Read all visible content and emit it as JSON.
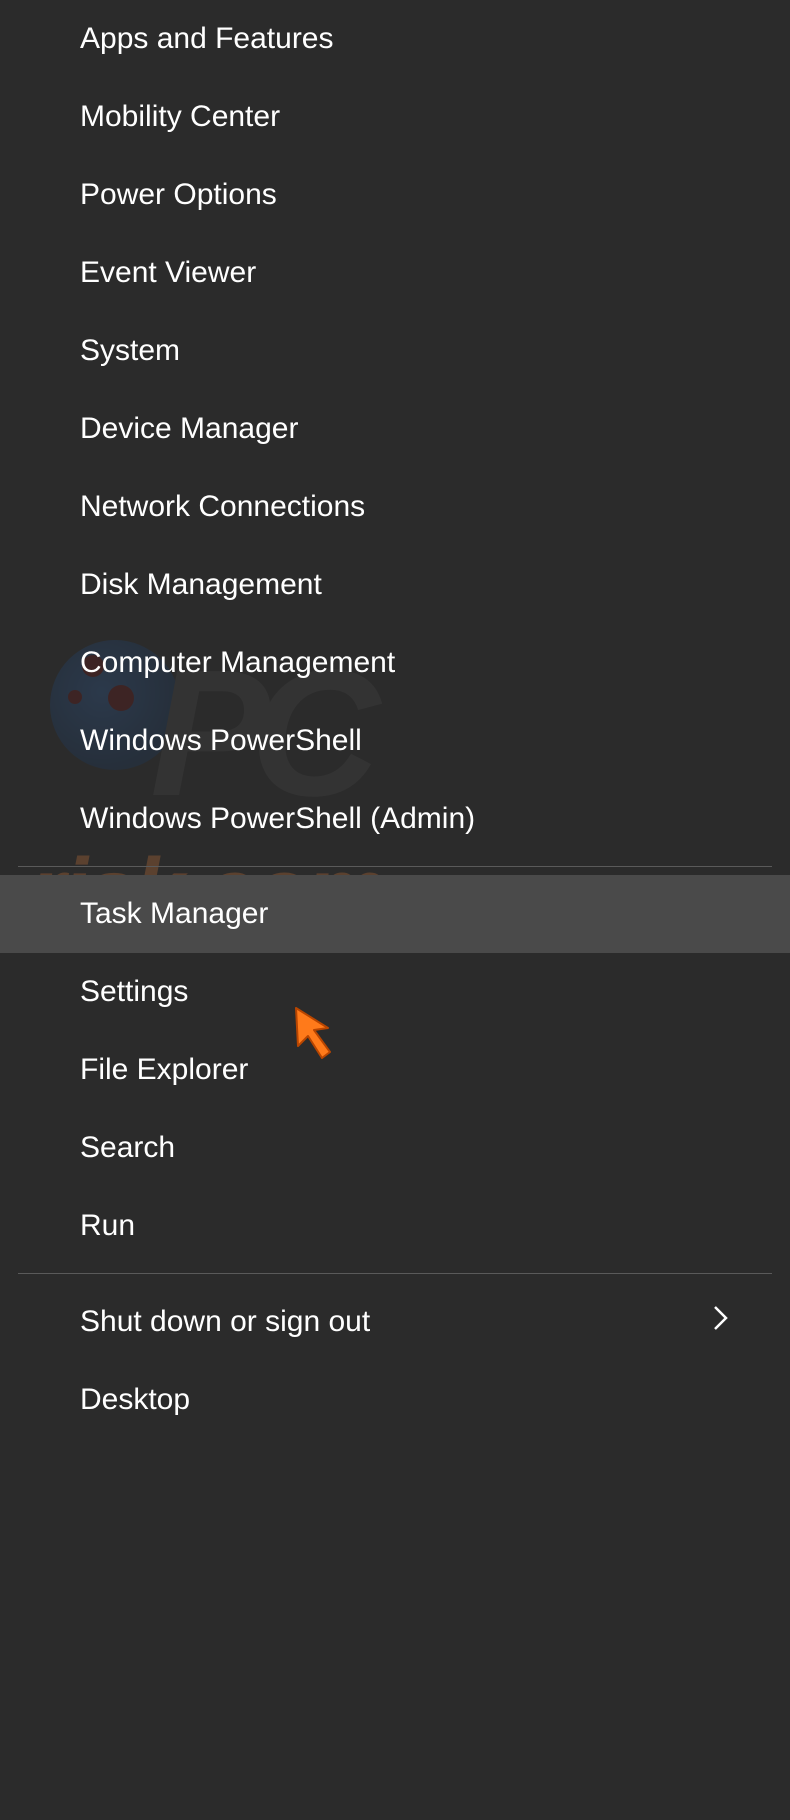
{
  "menu": {
    "groups": [
      {
        "items": [
          {
            "id": "apps-and-features",
            "label": "Apps and Features",
            "hasSubmenu": false,
            "highlighted": false
          },
          {
            "id": "mobility-center",
            "label": "Mobility Center",
            "hasSubmenu": false,
            "highlighted": false
          },
          {
            "id": "power-options",
            "label": "Power Options",
            "hasSubmenu": false,
            "highlighted": false
          },
          {
            "id": "event-viewer",
            "label": "Event Viewer",
            "hasSubmenu": false,
            "highlighted": false
          },
          {
            "id": "system",
            "label": "System",
            "hasSubmenu": false,
            "highlighted": false
          },
          {
            "id": "device-manager",
            "label": "Device Manager",
            "hasSubmenu": false,
            "highlighted": false
          },
          {
            "id": "network-connections",
            "label": "Network Connections",
            "hasSubmenu": false,
            "highlighted": false
          },
          {
            "id": "disk-management",
            "label": "Disk Management",
            "hasSubmenu": false,
            "highlighted": false
          },
          {
            "id": "computer-management",
            "label": "Computer Management",
            "hasSubmenu": false,
            "highlighted": false
          },
          {
            "id": "windows-powershell",
            "label": "Windows PowerShell",
            "hasSubmenu": false,
            "highlighted": false
          },
          {
            "id": "windows-powershell-admin",
            "label": "Windows PowerShell (Admin)",
            "hasSubmenu": false,
            "highlighted": false
          }
        ]
      },
      {
        "items": [
          {
            "id": "task-manager",
            "label": "Task Manager",
            "hasSubmenu": false,
            "highlighted": true
          },
          {
            "id": "settings",
            "label": "Settings",
            "hasSubmenu": false,
            "highlighted": false
          },
          {
            "id": "file-explorer",
            "label": "File Explorer",
            "hasSubmenu": false,
            "highlighted": false
          },
          {
            "id": "search",
            "label": "Search",
            "hasSubmenu": false,
            "highlighted": false
          },
          {
            "id": "run",
            "label": "Run",
            "hasSubmenu": false,
            "highlighted": false
          }
        ]
      },
      {
        "items": [
          {
            "id": "shut-down-or-sign-out",
            "label": "Shut down or sign out",
            "hasSubmenu": true,
            "highlighted": false
          },
          {
            "id": "desktop",
            "label": "Desktop",
            "hasSubmenu": false,
            "highlighted": false
          }
        ]
      }
    ]
  },
  "watermark": {
    "brand_upper": "PC",
    "brand_lower": "risk.com"
  }
}
